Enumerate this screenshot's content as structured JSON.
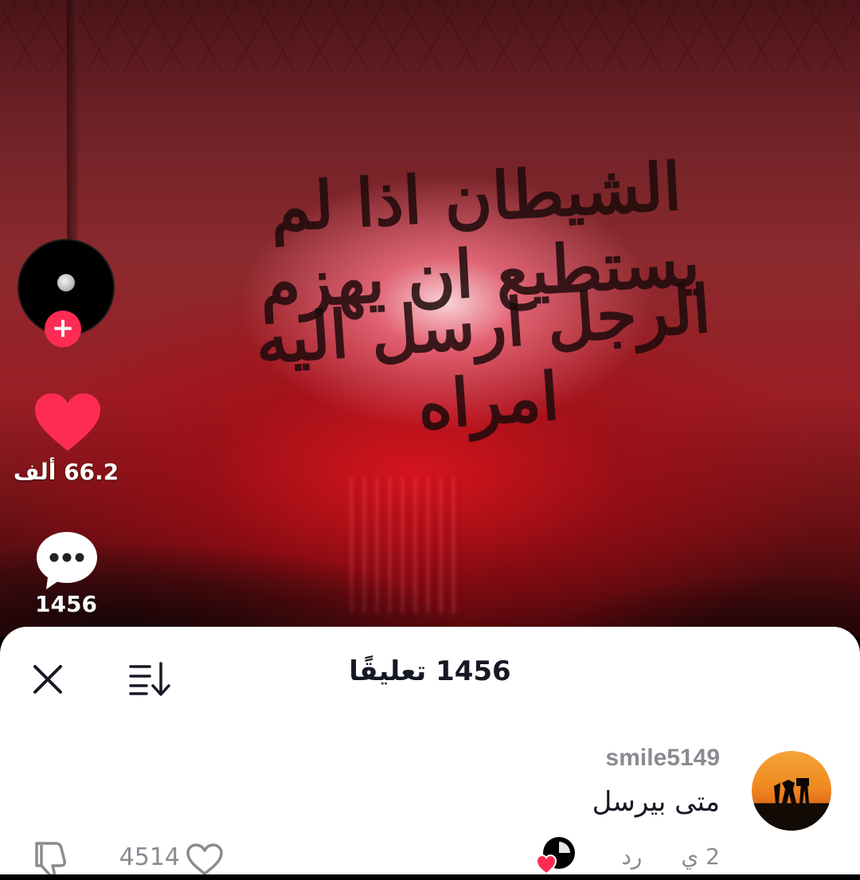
{
  "video": {
    "graffiti_line1": "الشيطان اذا لم يستطيع ان يهزم",
    "graffiti_line2": "الرجل ارسل اليه امراه"
  },
  "rail": {
    "follow_symbol": "+",
    "like_count": "66.2 ألف",
    "comment_count": "1456",
    "like_color": "#fe2c55"
  },
  "sheet": {
    "title": "1456 تعليقًا",
    "close_icon": "close-icon",
    "sort_icon": "sort-icon"
  },
  "comment": {
    "username": "smile5149",
    "text": "متى بيرسل",
    "time": "2 ي",
    "reply_label": "رد",
    "like_count": "4514"
  },
  "colors": {
    "accent": "#fe2c55",
    "text_primary": "#161823",
    "text_secondary": "#8a8b91"
  }
}
